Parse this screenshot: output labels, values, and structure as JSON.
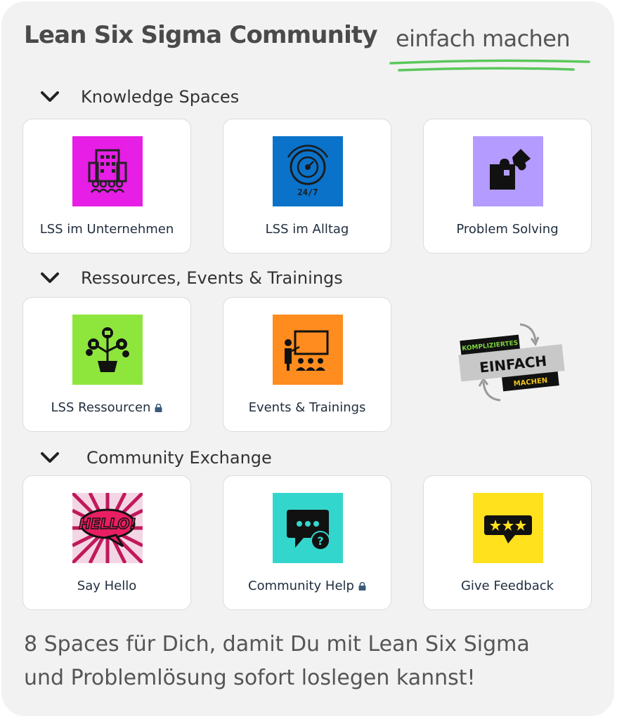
{
  "header": {
    "title": "Lean Six Sigma Community",
    "subtitle": "einfach machen",
    "accent": "#5ac85a"
  },
  "sections": [
    {
      "label": "Knowledge Spaces",
      "cards": [
        {
          "label": "LSS im Unternehmen",
          "icon": "company-building-icon",
          "color": "#e61ee6"
        },
        {
          "label": "LSS im Alltag",
          "icon": "clock-24-7-icon",
          "color": "#0a72c9"
        },
        {
          "label": "Problem Solving",
          "icon": "puzzle-icon",
          "color": "#b49bff"
        }
      ]
    },
    {
      "label": "Ressources, Events & Trainings",
      "cards": [
        {
          "label": "LSS Ressourcen",
          "icon": "plant-resources-icon",
          "color": "#8ee63c",
          "locked": true
        },
        {
          "label": "Events & Trainings",
          "icon": "presentation-icon",
          "color": "#ff8c1e"
        }
      ]
    },
    {
      "label": "Community Exchange",
      "cards": [
        {
          "label": "Say Hello",
          "icon": "hello-bubble-icon",
          "color": "#c2185b"
        },
        {
          "label": "Community Help",
          "icon": "chat-question-icon",
          "color": "#33d6cc",
          "locked": true
        },
        {
          "label": "Give Feedback",
          "icon": "star-rating-icon",
          "color": "#ffe11e"
        }
      ]
    }
  ],
  "logo": {
    "line1": "KOMPLIZIERTES",
    "line2": "EINFACH",
    "line3": "MACHEN"
  },
  "footer": {
    "line1": "8 Spaces für Dich, damit Du mit Lean Six Sigma",
    "line2": "und Problemlösung sofort loslegen kannst!"
  }
}
